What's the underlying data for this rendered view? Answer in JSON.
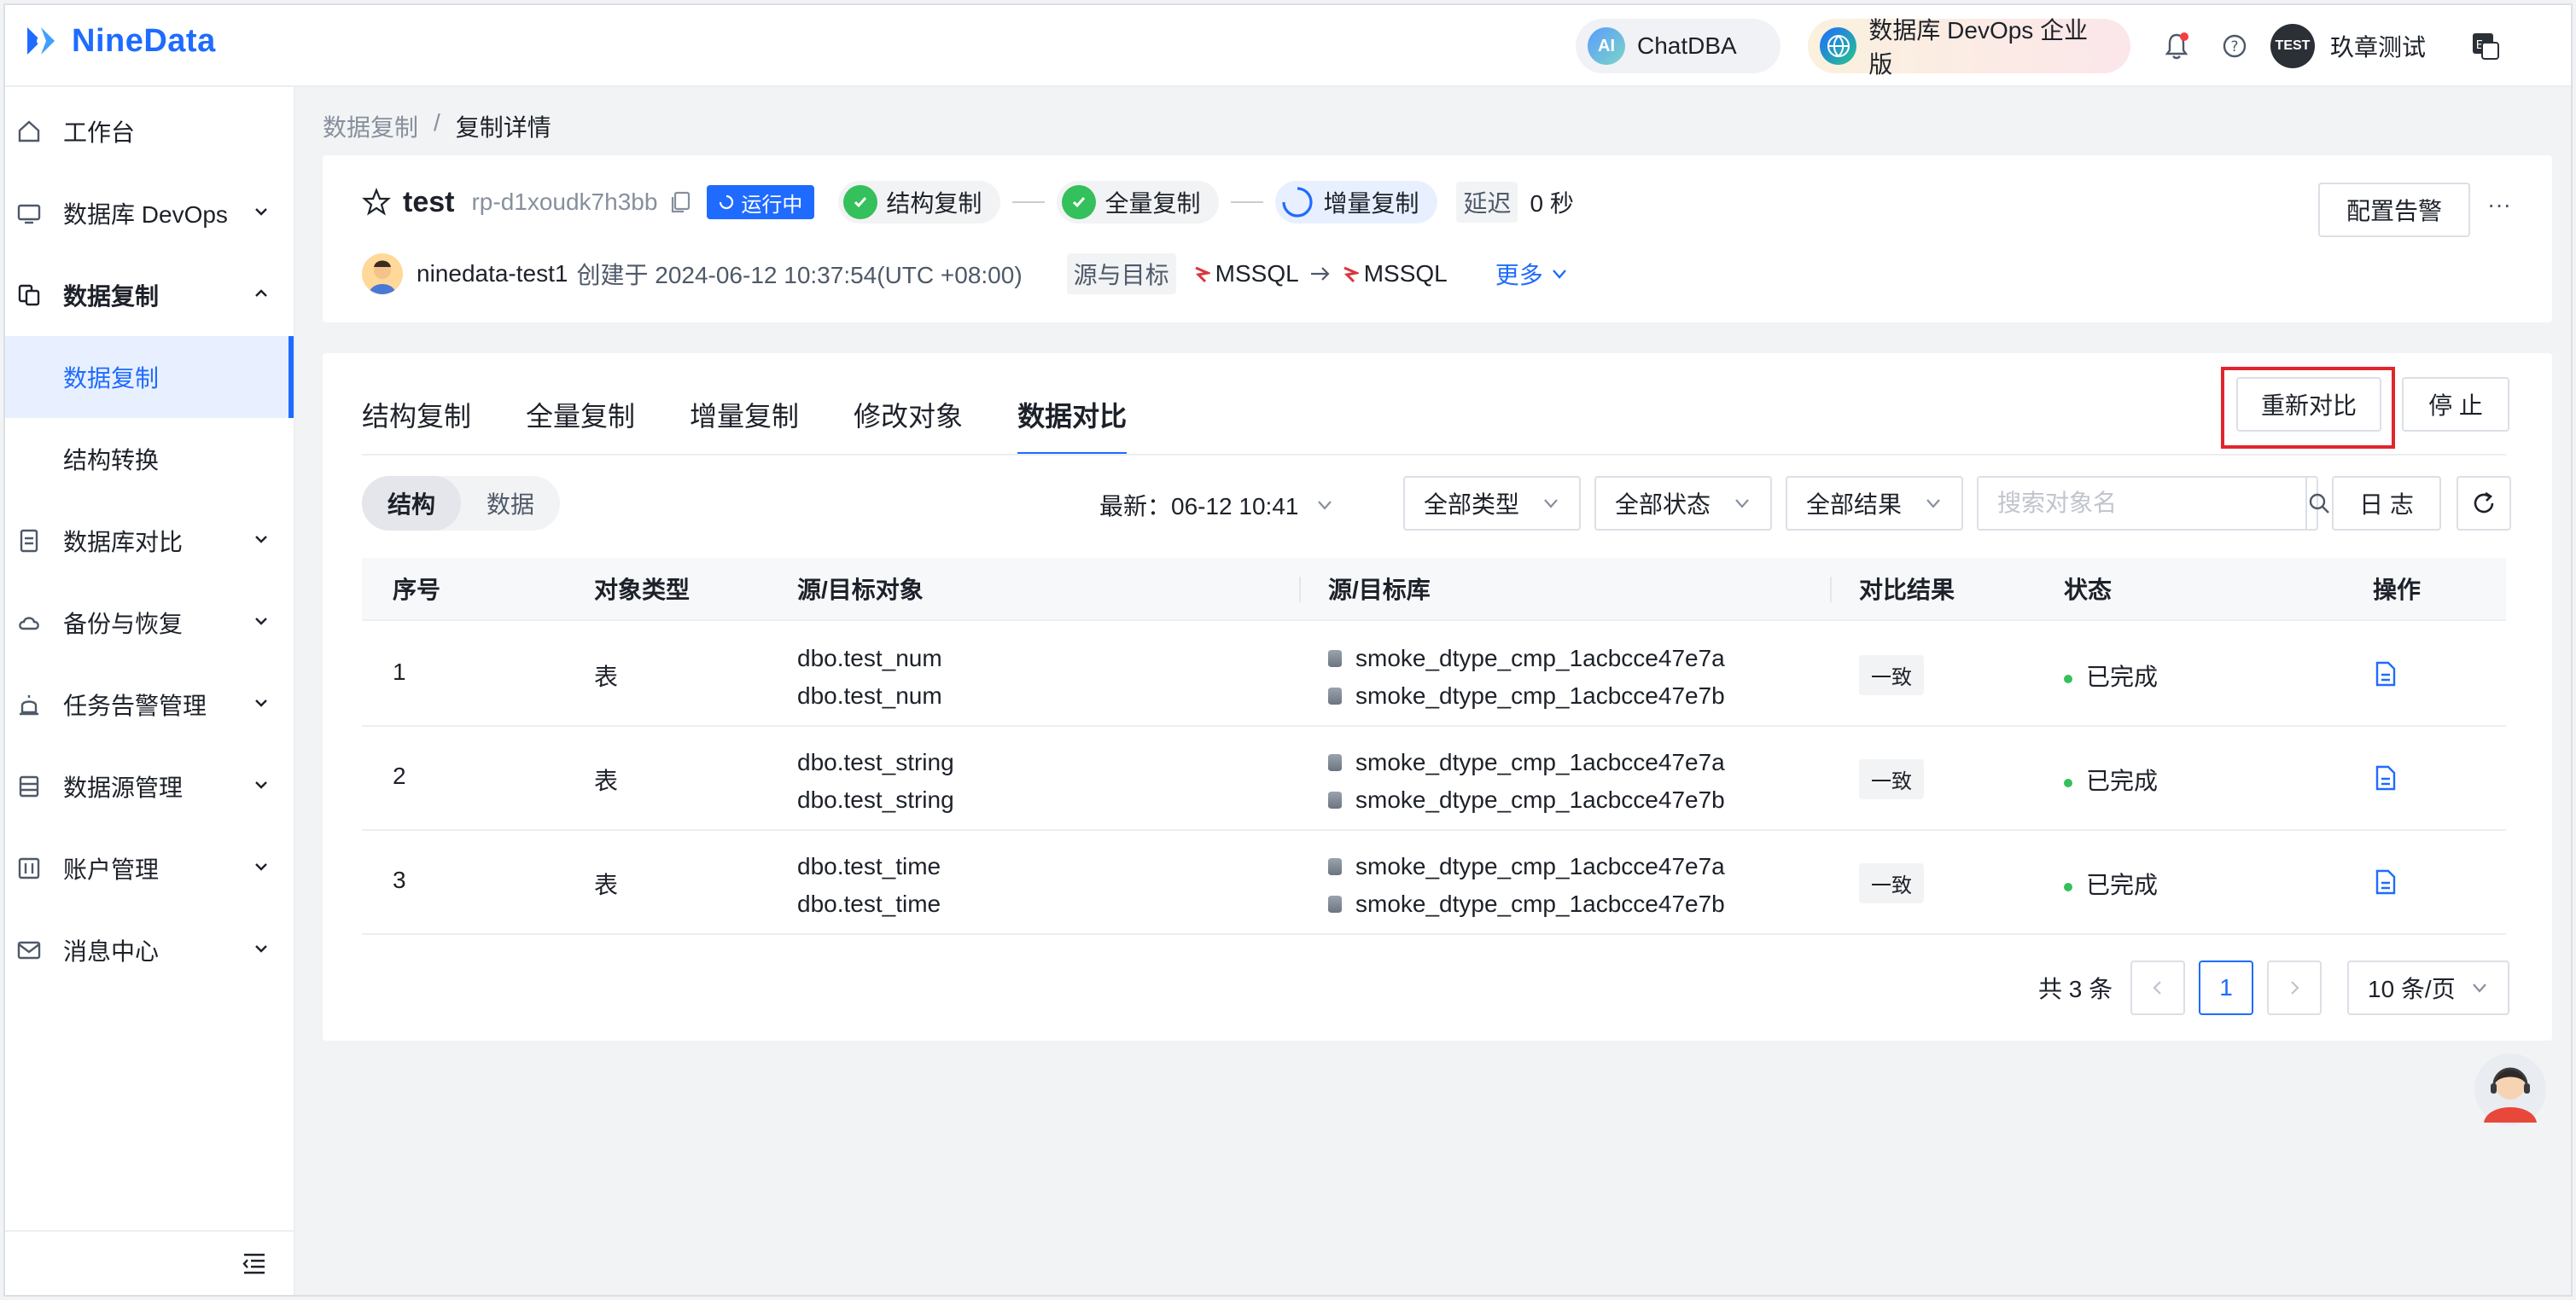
{
  "brand": {
    "name": "NineData"
  },
  "header": {
    "chatdba_label": "ChatDBA",
    "chatdba_icon_text": "AI",
    "devops_label": "数据库 DevOps 企业版",
    "user_name": "玖章测试",
    "user_avatar_text": "TEST"
  },
  "sidebar": {
    "items": [
      {
        "label": "工作台",
        "icon": "home-icon"
      },
      {
        "label": "数据库 DevOps",
        "icon": "sql-console-icon",
        "expandable": true
      },
      {
        "label": "数据复制",
        "icon": "replication-icon",
        "expanded": true
      },
      {
        "label": "数据库对比",
        "icon": "compare-icon",
        "expandable": true
      },
      {
        "label": "备份与恢复",
        "icon": "cloud-backup-icon",
        "expandable": true
      },
      {
        "label": "任务告警管理",
        "icon": "alarm-icon",
        "expandable": true
      },
      {
        "label": "数据源管理",
        "icon": "datasource-icon",
        "expandable": true
      },
      {
        "label": "账户管理",
        "icon": "account-icon",
        "expandable": true
      },
      {
        "label": "消息中心",
        "icon": "mail-icon",
        "expandable": true
      }
    ],
    "subitems": [
      {
        "label": "数据复制",
        "active": true
      },
      {
        "label": "结构转换",
        "active": false
      }
    ]
  },
  "breadcrumb": {
    "parent": "数据复制",
    "separator": "/",
    "current": "复制详情"
  },
  "task": {
    "name": "test",
    "id": "rp-d1xoudk7h3bb",
    "status": "运行中",
    "stages": [
      "结构复制",
      "全量复制",
      "增量复制"
    ],
    "delay_label": "延迟",
    "delay_value": "0 秒",
    "creator": "ninedata-test1",
    "created_text": "创建于 2024-06-12 10:37:54(UTC +08:00)",
    "src_target_label": "源与目标",
    "source_db": "MSSQL",
    "target_db": "MSSQL",
    "more_label": "更多",
    "alert_button": "配置告警",
    "more_icon": "···"
  },
  "tabs": [
    "结构复制",
    "全量复制",
    "增量复制",
    "修改对象",
    "数据对比"
  ],
  "active_tab": 4,
  "actions": {
    "recompare": "重新对比",
    "stop": "停 止"
  },
  "compare": {
    "segments": [
      "结构",
      "数据"
    ],
    "latest_label": "最新：06-12 10:41",
    "filters": {
      "type": "全部类型",
      "status": "全部状态",
      "result": "全部结果"
    },
    "search_placeholder": "搜索对象名",
    "log_button": "日 志"
  },
  "table": {
    "columns": [
      "序号",
      "对象类型",
      "源/目标对象",
      "源/目标库",
      "对比结果",
      "状态",
      "操作"
    ],
    "rows": [
      {
        "no": "1",
        "type": "表",
        "src_obj": "dbo.test_num",
        "dst_obj": "dbo.test_num",
        "src_db": "smoke_dtype_cmp_1acbcce47e7a",
        "dst_db": "smoke_dtype_cmp_1acbcce47e7b",
        "result": "一致",
        "status": "已完成"
      },
      {
        "no": "2",
        "type": "表",
        "src_obj": "dbo.test_string",
        "dst_obj": "dbo.test_string",
        "src_db": "smoke_dtype_cmp_1acbcce47e7a",
        "dst_db": "smoke_dtype_cmp_1acbcce47e7b",
        "result": "一致",
        "status": "已完成"
      },
      {
        "no": "3",
        "type": "表",
        "src_obj": "dbo.test_time",
        "dst_obj": "dbo.test_time",
        "src_db": "smoke_dtype_cmp_1acbcce47e7a",
        "dst_db": "smoke_dtype_cmp_1acbcce47e7b",
        "result": "一致",
        "status": "已完成"
      }
    ]
  },
  "pagination": {
    "total": "共 3 条",
    "current": "1",
    "page_size": "10 条/页"
  },
  "colors": {
    "primary": "#1f6bff",
    "success": "#34c05a",
    "highlight": "#e0262c"
  }
}
